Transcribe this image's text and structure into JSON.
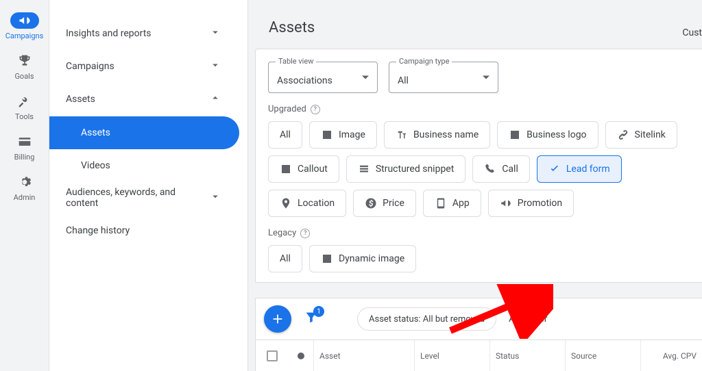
{
  "rail": {
    "campaigns": "Campaigns",
    "goals": "Goals",
    "tools": "Tools",
    "billing": "Billing",
    "admin": "Admin"
  },
  "nav": {
    "insights": "Insights and reports",
    "campaigns": "Campaigns",
    "assets": "Assets",
    "assets_sub": "Assets",
    "videos_sub": "Videos",
    "audiences": "Audiences, keywords, and content",
    "change_history": "Change history"
  },
  "page": {
    "title": "Assets",
    "right_truncated": "Cust"
  },
  "selects": {
    "table_view": {
      "label": "Table view",
      "value": "Associations"
    },
    "campaign_type": {
      "label": "Campaign type",
      "value": "All"
    }
  },
  "sections": {
    "upgraded": "Upgraded",
    "legacy": "Legacy"
  },
  "chips_upgraded": {
    "all": "All",
    "image": "Image",
    "business_name": "Business name",
    "business_logo": "Business logo",
    "sitelink": "Sitelink",
    "callout": "Callout",
    "structured_snippet": "Structured snippet",
    "call": "Call",
    "lead_form": "Lead form",
    "location": "Location",
    "price": "Price",
    "app": "App",
    "promotion": "Promotion"
  },
  "chips_legacy": {
    "all": "All",
    "dynamic_image": "Dynamic image"
  },
  "toolbar": {
    "filter_badge": "1",
    "status_pill": "Asset status: All but removed",
    "add_filter": "Add filter"
  },
  "table": {
    "columns": {
      "asset": "Asset",
      "level": "Level",
      "status": "Status",
      "source": "Source",
      "avg_cpv": "Avg. CPV"
    }
  }
}
